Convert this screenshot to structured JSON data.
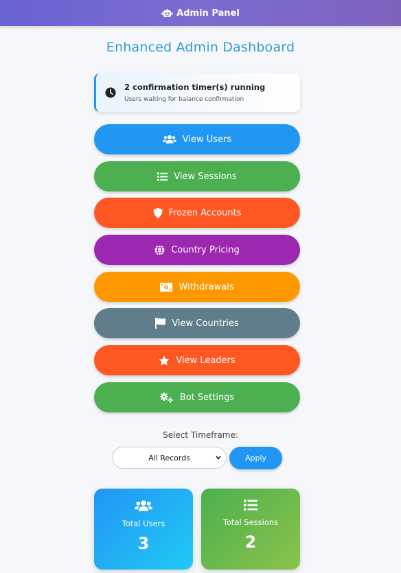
{
  "header": {
    "title": "Admin Panel",
    "icon": "robot-icon"
  },
  "page_title": "Enhanced Admin Dashboard",
  "timer_notice": {
    "title": "2 confirmation timer(s) running",
    "subtitle": "Users waiting for balance confirmation",
    "icon": "clock-icon",
    "accent": "#2196f3"
  },
  "menu": [
    {
      "label": "View Users",
      "icon": "users-icon",
      "color": "#2196f3"
    },
    {
      "label": "View Sessions",
      "icon": "list-icon",
      "color": "#4caf50"
    },
    {
      "label": "Frozen Accounts",
      "icon": "shield-icon",
      "color": "#ff5722"
    },
    {
      "label": "Country Pricing",
      "icon": "globe-icon",
      "color": "#9c27b0"
    },
    {
      "label": "Withdrawals",
      "icon": "money-icon",
      "color": "#ff9800"
    },
    {
      "label": "View Countries",
      "icon": "flag-icon",
      "color": "#607d8b"
    },
    {
      "label": "View Leaders",
      "icon": "star-icon",
      "color": "#ff5722"
    },
    {
      "label": "Bot Settings",
      "icon": "gears-icon",
      "color": "#4caf50"
    }
  ],
  "timeframe": {
    "label": "Select Timeframe:",
    "selected": "All Records",
    "apply_label": "Apply"
  },
  "stats": [
    {
      "label": "Total Users",
      "value": "3",
      "icon": "users-icon"
    },
    {
      "label": "Total Sessions",
      "value": "2",
      "icon": "list-icon"
    }
  ]
}
